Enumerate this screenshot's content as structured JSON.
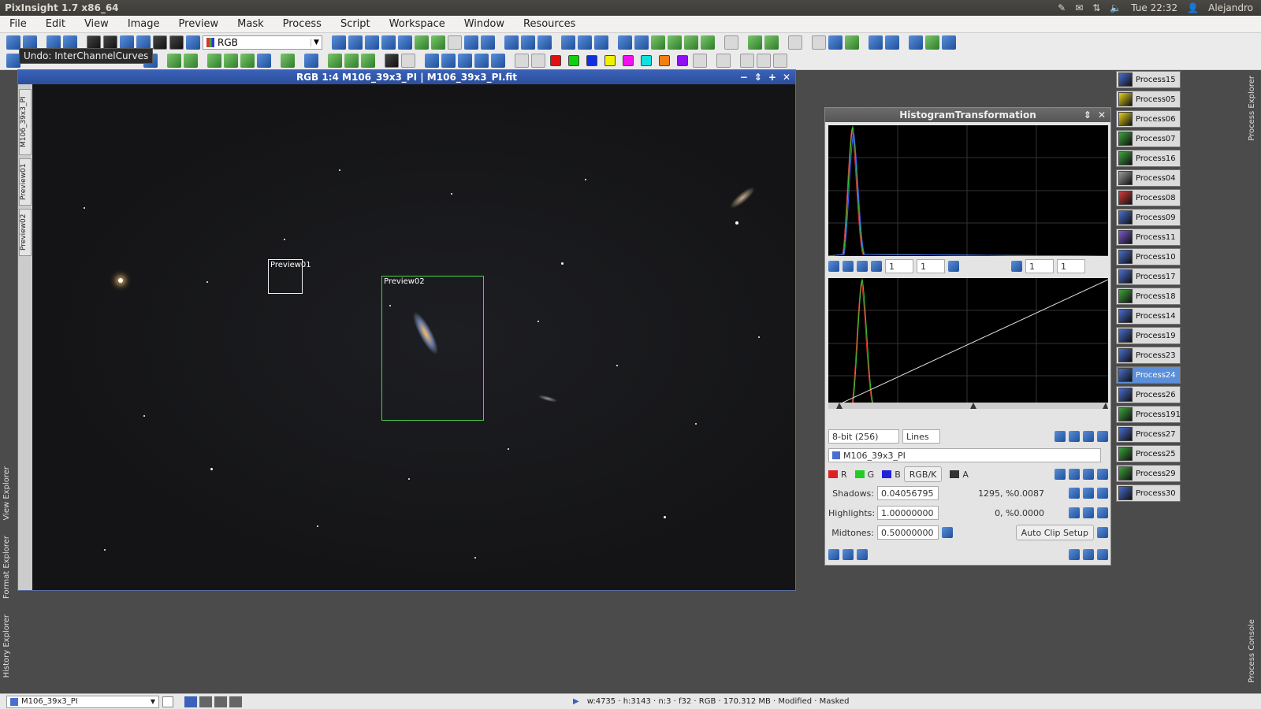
{
  "app": {
    "title": "PixInsight 1.7 x86_64",
    "clock": "Tue 22:32",
    "user": "Alejandro"
  },
  "menu": [
    "File",
    "Edit",
    "View",
    "Image",
    "Preview",
    "Mask",
    "Process",
    "Script",
    "Workspace",
    "Window",
    "Resources"
  ],
  "toolbar": {
    "channel_select": "RGB",
    "tooltip": "Undo: InterChannelCurves"
  },
  "left_tabs": [
    "View Explorer",
    "Format Explorer",
    "History Explorer"
  ],
  "right_tabs": [
    "Process Explorer",
    "Process Console"
  ],
  "image_window": {
    "title": "RGB 1:4 M106_39x3_PI | M106_39x3_PI.fit",
    "side_tabs": [
      "M106_39x3_PI",
      "Preview01",
      "Preview02"
    ],
    "previews": [
      "Preview01",
      "Preview02"
    ]
  },
  "histogram": {
    "title": "HistogramTransformation",
    "zoom_h": "1",
    "zoom_v": "1",
    "zoom_h2": "1",
    "zoom_v2": "1",
    "resolution": "8-bit (256)",
    "plot_mode": "Lines",
    "view": "M106_39x3_PI",
    "channels": [
      "R",
      "G",
      "B",
      "RGB/K",
      "A"
    ],
    "shadows_label": "Shadows:",
    "shadows": "0.04056795",
    "shadows_info": "1295, %0.0087",
    "highlights_label": "Highlights:",
    "highlights": "1.00000000",
    "highlights_info": "0, %0.0000",
    "midtones_label": "Midtones:",
    "midtones": "0.50000000",
    "auto_clip": "Auto Clip Setup"
  },
  "processes": [
    {
      "name": "Process15",
      "color": "#4a6ed0"
    },
    {
      "name": "Process05",
      "color": "#e6d21c"
    },
    {
      "name": "Process06",
      "color": "#e6d21c"
    },
    {
      "name": "Process07",
      "color": "#3fa33f"
    },
    {
      "name": "Process16",
      "color": "#3fa33f"
    },
    {
      "name": "Process04",
      "color": "#9a9a9a"
    },
    {
      "name": "Process08",
      "color": "#d63a3a"
    },
    {
      "name": "Process09",
      "color": "#4a6ed0"
    },
    {
      "name": "Process11",
      "color": "#7a5ad0"
    },
    {
      "name": "Process10",
      "color": "#4a6ed0"
    },
    {
      "name": "Process17",
      "color": "#4a6ed0"
    },
    {
      "name": "Process18",
      "color": "#3fa33f"
    },
    {
      "name": "Process14",
      "color": "#4a6ed0"
    },
    {
      "name": "Process19",
      "color": "#4a6ed0"
    },
    {
      "name": "Process23",
      "color": "#4a6ed0"
    },
    {
      "name": "Process24",
      "color": "#4a6ed0",
      "selected": true
    },
    {
      "name": "Process26",
      "color": "#4a6ed0"
    },
    {
      "name": "Process191",
      "color": "#3fa33f"
    },
    {
      "name": "Process27",
      "color": "#4a6ed0"
    },
    {
      "name": "Process25",
      "color": "#3fa33f"
    },
    {
      "name": "Process29",
      "color": "#3fa33f"
    },
    {
      "name": "Process30",
      "color": "#4a6ed0"
    }
  ],
  "status": {
    "view": "M106_39x3_PI",
    "info": "w:4735 · h:3143 · n:3 · f32 · RGB · 170.312 MB · Modified · Masked"
  }
}
